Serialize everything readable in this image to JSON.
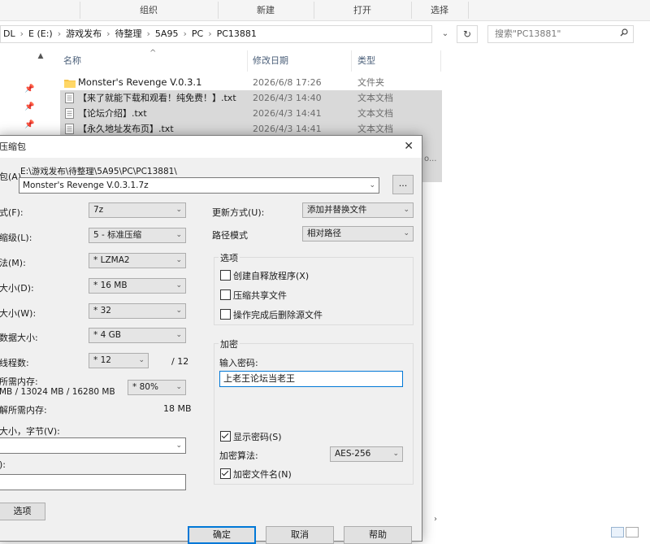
{
  "explorer": {
    "ribbon": [
      "组织",
      "新建",
      "打开",
      "选择"
    ],
    "breadcrumbs": [
      "DL",
      "E (E:)",
      "游戏发布",
      "待整理",
      "5A95",
      "PC",
      "PC13881"
    ],
    "search_placeholder": "搜索\"PC13881\"",
    "columns": {
      "name": "名称",
      "date": "修改日期",
      "type": "类型"
    },
    "files": [
      {
        "name": "Monster's Revenge V.0.3.1",
        "date": "2026/6/8 17:26",
        "type": "文件夹",
        "icon": "folder-icon",
        "selected": false
      },
      {
        "name": "【来了就能下载和观看！纯免费！】.txt",
        "date": "2026/4/3 14:40",
        "type": "文本文档",
        "icon": "text-file-icon",
        "selected": true
      },
      {
        "name": "【论坛介绍】.txt",
        "date": "2026/4/3 14:41",
        "type": "文本文档",
        "icon": "text-file-icon",
        "selected": true
      },
      {
        "name": "【永久地址发布页】.txt",
        "date": "2026/4/3 14:41",
        "type": "文本文档",
        "icon": "text-file-icon",
        "selected": true
      }
    ],
    "partial_type": "o..."
  },
  "dialog": {
    "title": "压缩包",
    "archive_label": "包(A)",
    "archive_path": "E:\\游戏发布\\待整理\\5A95\\PC\\PC13881\\",
    "archive_name": "Monster's Revenge V.0.3.1.7z",
    "browse": "...",
    "left": {
      "format_label": "式(F):",
      "format": "7z",
      "level_label": "缩级(L):",
      "level": "5 - 标准压缩",
      "method_label": "法(M):",
      "method": "* LZMA2",
      "dict_label": "大小(D):",
      "dict": "* 16 MB",
      "word_label": "大小(W):",
      "word": "* 32",
      "solid_label": "数据大小:",
      "solid": "* 4 GB",
      "threads_label": "线程数:",
      "threads": "* 12",
      "threads_max": "/ 12",
      "mem_label": "所需内存:",
      "mem_value": "MB / 13024 MB / 16280 MB",
      "mem_pct": "* 80%",
      "dmem_label": "解所需内存:",
      "dmem_value": "18 MB",
      "split_label": "大小，字节(V):",
      "params_label": "):",
      "options_btn": "选项"
    },
    "right": {
      "update_label": "更新方式(U):",
      "update": "添加并替换文件",
      "path_label": "路径模式",
      "path": "相对路径",
      "options_group": "选项",
      "sfx": "创建自释放程序(X)",
      "shared": "压缩共享文件",
      "delete": "操作完成后删除源文件",
      "enc_group": "加密",
      "pwd_label": "输入密码:",
      "pwd": "上老王论坛当老王",
      "show_pwd": "显示密码(S)",
      "enc_method_label": "加密算法:",
      "enc_method": "AES-256",
      "enc_names": "加密文件名(N)"
    },
    "buttons": {
      "ok": "确定",
      "cancel": "取消",
      "help": "帮助"
    }
  }
}
